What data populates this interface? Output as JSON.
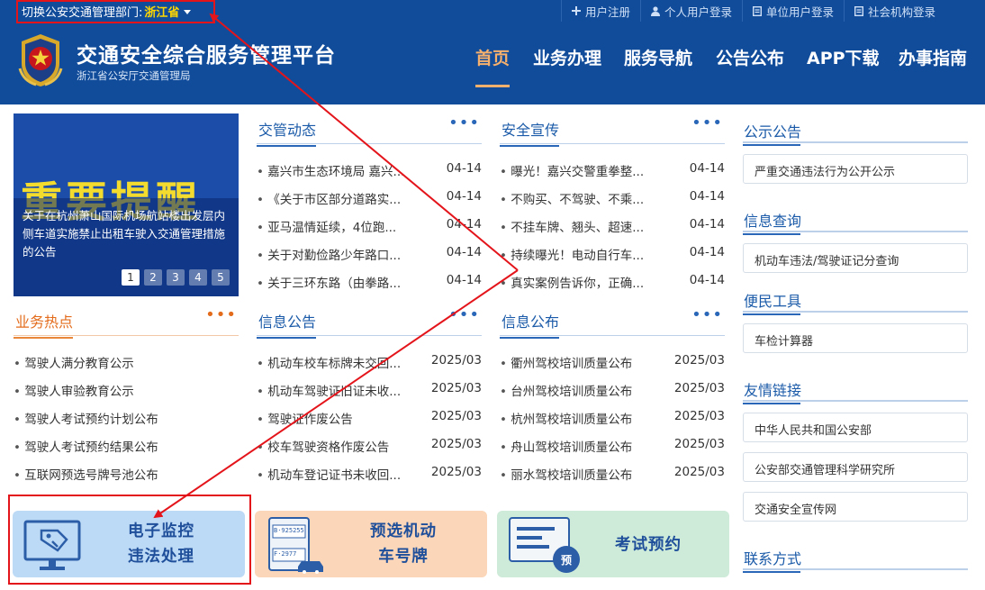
{
  "topbar": {
    "region_prefix": "切换公安交通管理部门:",
    "region_name": "浙江省",
    "links": [
      {
        "label": "用户注册",
        "icon": "plus-icon"
      },
      {
        "label": "个人用户登录",
        "icon": "user-icon"
      },
      {
        "label": "单位用户登录",
        "icon": "document-icon"
      },
      {
        "label": "社会机构登录",
        "icon": "document-icon"
      }
    ]
  },
  "header": {
    "title": "交通安全综合服务管理平台",
    "subtitle": "浙江省公安厅交通管理局",
    "nav": [
      "首页",
      "业务办理",
      "服务导航",
      "公告公布",
      "APP下载",
      "办事指南"
    ],
    "active_nav": "首页"
  },
  "slider": {
    "banner_text": "重要提醒",
    "caption": "关于在杭州萧山国际机场航站楼出发层内侧车道实施禁止出租车驶入交通管理措施的公告",
    "pages": [
      "1",
      "2",
      "3",
      "4",
      "5"
    ],
    "current_page": "1"
  },
  "traffic_news": {
    "title": "交管动态",
    "more": "•••",
    "items": [
      {
        "text": "嘉兴市生态环境局 嘉兴...",
        "date": "04-14"
      },
      {
        "text": "《关于市区部分道路实...",
        "date": "04-14"
      },
      {
        "text": "亚马温情延续，4位跑...",
        "date": "04-14"
      },
      {
        "text": "关于对勤俭路少年路口...",
        "date": "04-14"
      },
      {
        "text": "关于三环东路（由拳路...",
        "date": "04-14"
      }
    ]
  },
  "safety_promo": {
    "title": "安全宣传",
    "more": "•••",
    "items": [
      {
        "text": "曝光！嘉兴交警重拳整...",
        "date": "04-14"
      },
      {
        "text": "不购买、不驾驶、不乘...",
        "date": "04-14"
      },
      {
        "text": "不挂车牌、翘头、超速...",
        "date": "04-14"
      },
      {
        "text": "持续曝光！电动自行车...",
        "date": "04-14"
      },
      {
        "text": "真实案例告诉你，正确...",
        "date": "04-14"
      }
    ]
  },
  "hot_business": {
    "title": "业务热点",
    "more": "•••",
    "items": [
      "驾驶人满分教育公示",
      "驾驶人审验教育公示",
      "驾驶人考试预约计划公布",
      "驾驶人考试预约结果公布",
      "互联网预选号牌号池公布"
    ]
  },
  "info_notice": {
    "title": "信息公告",
    "more": "•••",
    "items": [
      {
        "text": "机动车校车标牌未交回...",
        "date": "2025/03"
      },
      {
        "text": "机动车驾驶证旧证未收...",
        "date": "2025/03"
      },
      {
        "text": "驾驶证作废公告",
        "date": "2025/03"
      },
      {
        "text": "校车驾驶资格作废公告",
        "date": "2025/03"
      },
      {
        "text": "机动车登记证书未收回...",
        "date": "2025/03"
      }
    ]
  },
  "info_publish": {
    "title": "信息公布",
    "more": "•••",
    "items": [
      {
        "text": "衢州驾校培训质量公布",
        "date": "2025/03"
      },
      {
        "text": "台州驾校培训质量公布",
        "date": "2025/03"
      },
      {
        "text": "杭州驾校培训质量公布",
        "date": "2025/03"
      },
      {
        "text": "舟山驾校培训质量公布",
        "date": "2025/03"
      },
      {
        "text": "丽水驾校培训质量公布",
        "date": "2025/03"
      }
    ]
  },
  "sidebar": {
    "public_notice": {
      "title": "公示公告",
      "links": [
        "严重交通违法行为公开公示"
      ]
    },
    "info_query": {
      "title": "信息查询",
      "links": [
        "机动车违法/驾驶证记分查询"
      ]
    },
    "tools": {
      "title": "便民工具",
      "links": [
        "车检计算器"
      ]
    },
    "friend_links": {
      "title": "友情链接",
      "links": [
        "中华人民共和国公安部",
        "公安部交通管理科学研究所",
        "交通安全宣传网"
      ]
    },
    "contact": {
      "title": "联系方式"
    }
  },
  "cards": [
    {
      "line1": "电子监控",
      "line2": "违法处理",
      "icon": "monitor-tag-icon",
      "color": "#bcdaf6",
      "text_color": "#1f4f9a"
    },
    {
      "line1": "预选机动",
      "line2": "车号牌",
      "icon": "license-plate-icon",
      "color": "#fbd6b8",
      "text_color": "#1f4f9a",
      "plate_top": "B·925255",
      "plate_bottom": "F·2977"
    },
    {
      "line1": "考试预约",
      "line2": "",
      "icon": "exam-booking-icon",
      "color": "#cdebd8",
      "text_color": "#1f4f9a",
      "badge": "预"
    }
  ],
  "colors": {
    "header_blue": "#114c9b",
    "nav_active": "#f5b06e",
    "accent_orange": "#e36c1c",
    "annotation_red": "#e4141b"
  }
}
